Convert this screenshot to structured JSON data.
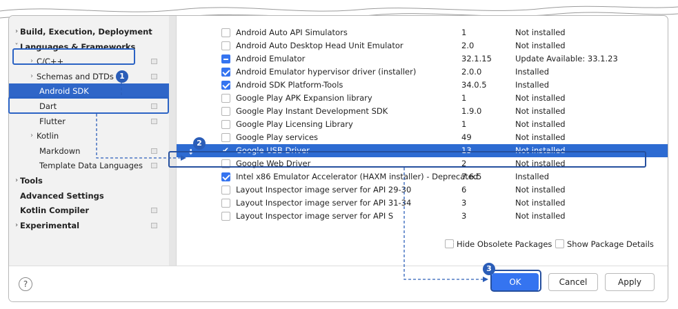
{
  "sidebar": {
    "items": [
      {
        "label": "Build, Execution, Deployment",
        "chevron": "›",
        "bold": true,
        "indent": 0,
        "page_icon": false,
        "selected": false
      },
      {
        "label": "Languages & Frameworks",
        "chevron": "˅",
        "bold": true,
        "indent": 0,
        "page_icon": false,
        "selected": false
      },
      {
        "label": "C/C++",
        "chevron": "›",
        "bold": false,
        "indent": 1,
        "page_icon": true,
        "selected": false
      },
      {
        "label": "Schemas and DTDs",
        "chevron": "›",
        "bold": false,
        "indent": 1,
        "page_icon": true,
        "selected": false
      },
      {
        "label": "Android SDK",
        "chevron": "",
        "bold": false,
        "indent": 2,
        "page_icon": false,
        "selected": true
      },
      {
        "label": "Dart",
        "chevron": "",
        "bold": false,
        "indent": 2,
        "page_icon": true,
        "selected": false
      },
      {
        "label": "Flutter",
        "chevron": "",
        "bold": false,
        "indent": 2,
        "page_icon": true,
        "selected": false
      },
      {
        "label": "Kotlin",
        "chevron": "›",
        "bold": false,
        "indent": 1,
        "page_icon": false,
        "selected": false
      },
      {
        "label": "Markdown",
        "chevron": "",
        "bold": false,
        "indent": 2,
        "page_icon": true,
        "selected": false
      },
      {
        "label": "Template Data Languages",
        "chevron": "",
        "bold": false,
        "indent": 2,
        "page_icon": true,
        "selected": false
      },
      {
        "label": "Tools",
        "chevron": "›",
        "bold": true,
        "indent": 0,
        "page_icon": false,
        "selected": false
      },
      {
        "label": "Advanced Settings",
        "chevron": "",
        "bold": true,
        "indent": 0,
        "page_icon": false,
        "selected": false
      },
      {
        "label": "Kotlin Compiler",
        "chevron": "",
        "bold": true,
        "indent": 0,
        "page_icon": true,
        "selected": false
      },
      {
        "label": "Experimental",
        "chevron": "›",
        "bold": true,
        "indent": 0,
        "page_icon": true,
        "selected": false
      }
    ]
  },
  "packages": [
    {
      "name": "Android Auto API Simulators",
      "version": "1",
      "status": "Not installed",
      "check": "none",
      "selected": false
    },
    {
      "name": "Android Auto Desktop Head Unit Emulator",
      "version": "2.0",
      "status": "Not installed",
      "check": "none",
      "selected": false
    },
    {
      "name": "Android Emulator",
      "version": "32.1.15",
      "status": "Update Available: 33.1.23",
      "check": "partial",
      "selected": false
    },
    {
      "name": "Android Emulator hypervisor driver (installer)",
      "version": "2.0.0",
      "status": "Installed",
      "check": "checked",
      "selected": false
    },
    {
      "name": "Android SDK Platform-Tools",
      "version": "34.0.5",
      "status": "Installed",
      "check": "checked",
      "selected": false
    },
    {
      "name": "Google Play APK Expansion library",
      "version": "1",
      "status": "Not installed",
      "check": "none",
      "selected": false
    },
    {
      "name": "Google Play Instant Development SDK",
      "version": "1.9.0",
      "status": "Not installed",
      "check": "none",
      "selected": false
    },
    {
      "name": "Google Play Licensing Library",
      "version": "1",
      "status": "Not installed",
      "check": "none",
      "selected": false
    },
    {
      "name": "Google Play services",
      "version": "49",
      "status": "Not installed",
      "check": "none",
      "selected": false
    },
    {
      "name": "Google USB Driver",
      "version": "13",
      "status": "Not installed",
      "check": "checked",
      "selected": true
    },
    {
      "name": "Google Web Driver",
      "version": "2",
      "status": "Not installed",
      "check": "none",
      "selected": false
    },
    {
      "name": "Intel x86 Emulator Accelerator (HAXM installer) - Deprecated",
      "version": "7.6.5",
      "status": "Installed",
      "check": "checked",
      "selected": false
    },
    {
      "name": "Layout Inspector image server for API 29-30",
      "version": "6",
      "status": "Not installed",
      "check": "none",
      "selected": false
    },
    {
      "name": "Layout Inspector image server for API 31-34",
      "version": "3",
      "status": "Not installed",
      "check": "none",
      "selected": false
    },
    {
      "name": "Layout Inspector image server for API S",
      "version": "3",
      "status": "Not installed",
      "check": "none",
      "selected": false
    }
  ],
  "options": {
    "hide_obsolete_label": "Hide Obsolete Packages",
    "hide_obsolete_checked": true,
    "show_details_label": "Show Package Details",
    "show_details_checked": false
  },
  "footer": {
    "help_label": "?",
    "ok_label": "OK",
    "cancel_label": "Cancel",
    "apply_label": "Apply"
  },
  "annotations": {
    "badge_1": "1",
    "badge_2": "2",
    "badge_3": "3"
  },
  "colors": {
    "accent": "#3574f0",
    "selection": "#2d6bd2",
    "annotation": "#2a5db8"
  },
  "icons": {
    "download": "download-icon",
    "help": "help-icon",
    "page": "page-icon"
  }
}
